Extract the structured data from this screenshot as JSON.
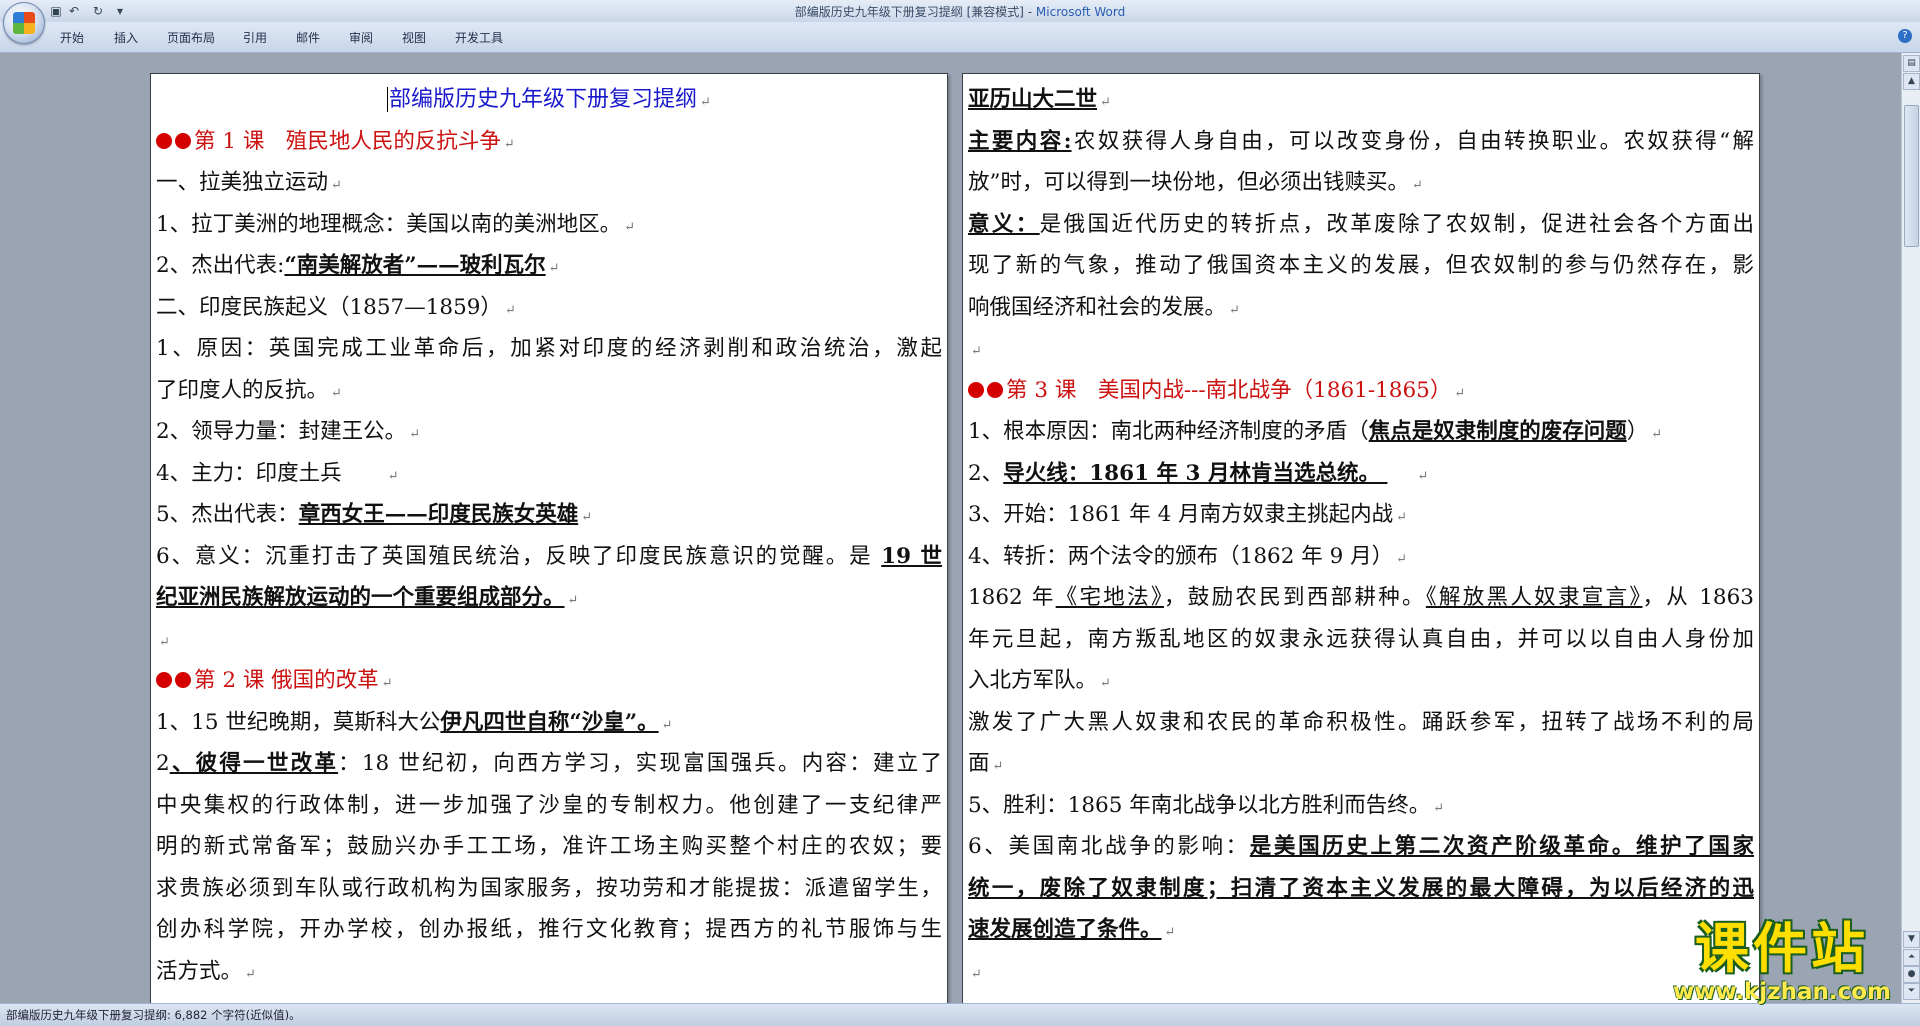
{
  "window": {
    "title": "部编版历史九年级下册复习提纲 [兼容模式] - ",
    "app": "Microsoft Word"
  },
  "ribbon_tabs": [
    "开始",
    "插入",
    "页面布局",
    "引用",
    "邮件",
    "审阅",
    "视图",
    "开发工具"
  ],
  "left_page": [
    [
      {
        "t": "部编版历史九年级下册复习提纲"
      }
    ],
    [
      {
        "t": "第 1 课　殖民地人民的反抗斗争"
      }
    ],
    [
      {
        "t": "一、拉美独立运动"
      }
    ],
    [
      {
        "t": "1、拉丁美洲的地理概念：美国以南的美洲地区。"
      }
    ],
    [
      {
        "t": "2、杰出代表:"
      },
      {
        "t": "“南美解放者”——玻利瓦尔"
      }
    ],
    [
      {
        "t": "二、印度民族起义（1857—1859）"
      }
    ],
    [
      {
        "t": "1、原因：英国完成工业革命后，加紧对印度的经济剥削和政治统治，激起"
      }
    ],
    [
      {
        "t": "了印度人的反抗。"
      }
    ],
    [
      {
        "t": "2、领导力量：封建王公。"
      }
    ],
    [
      {
        "t": "4、主力：印度土兵　　"
      }
    ],
    [
      {
        "t": "5、杰出代表："
      },
      {
        "t": "章西女王——印度民族女英雄"
      }
    ],
    [
      {
        "t": "6、意义：沉重打击了英国殖民统治，反映了印度民族意识的觉醒。是 "
      },
      {
        "t": "19 世"
      }
    ],
    [
      {
        "t": "纪亚洲民族解放运动的一个重要组成部分。"
      }
    ],
    [],
    [
      {
        "t": "第 2 课 俄国的改革"
      }
    ],
    [
      {
        "t": "1、15 世纪晚期，莫斯科大公"
      },
      {
        "t": "伊凡四世自称“沙皇”。"
      }
    ],
    [
      {
        "t": "2"
      },
      {
        "t": "、彼得一世改革"
      },
      {
        "t": "：18 世纪初，向西方学习，实现富国强兵。内容：建立了"
      }
    ],
    [
      {
        "t": "中央集权的行政体制，进一步加强了沙皇的专制权力。他创建了一支纪律严"
      }
    ],
    [
      {
        "t": "明的新式常备军；鼓励兴办手工工场，准许工场主购买整个村庄的农奴；要"
      }
    ],
    [
      {
        "t": "求贵族必须到车队或行政机构为国家服务，按功劳和才能提拔：派遣留学生，"
      }
    ],
    [
      {
        "t": "创办科学院，开办学校，创办报纸，推行文化教育；提西方的礼节服饰与生"
      }
    ],
    [
      {
        "t": "活方式。"
      }
    ]
  ],
  "right_page": [
    [
      {
        "t": "亚历山大二世"
      }
    ],
    [
      {
        "t": "主要内容:"
      },
      {
        "t": "农奴获得人身自由，可以改变身份，自由转换职业。农奴获得“解"
      }
    ],
    [
      {
        "t": "放”时，可以得到一块份地，但必须出钱赎买。"
      }
    ],
    [
      {
        "t": "意义："
      },
      {
        "t": "是俄国近代历史的转折点，改革废除了农奴制，促进社会各个方面出"
      }
    ],
    [
      {
        "t": "现了新的气象，推动了俄国资本主义的发展，但农奴制的参与仍然存在，影"
      }
    ],
    [
      {
        "t": "响俄国经济和社会的发展。"
      }
    ],
    [],
    [
      {
        "t": "第 3 课　美国内战---南北战争（1861-1865）"
      }
    ],
    [
      {
        "t": "1、根本原因：南北两种经济制度的矛盾（"
      },
      {
        "t": "焦点是奴隶制度的废存问题"
      },
      {
        "t": "）"
      }
    ],
    [
      {
        "t": "2、"
      },
      {
        "t": "导火线：1861 年 3 月林肯当选总统。 "
      }
    ],
    [
      {
        "t": "3、开始：1861 年 4 月南方奴隶主挑起内战"
      }
    ],
    [
      {
        "t": "4、转折：两个法令的颁布（1862 年 9 月）"
      }
    ],
    [
      {
        "t": "1862 年"
      },
      {
        "t": "《宅地法》"
      },
      {
        "t": "，鼓励农民到西部耕种。"
      },
      {
        "t": "《解放黑人奴隶宣言》"
      },
      {
        "t": "，从 1863"
      }
    ],
    [
      {
        "t": "年元旦起，南方叛乱地区的奴隶永远获得认真自由，并可以以自由人身份加"
      }
    ],
    [
      {
        "t": "入北方军队。"
      }
    ],
    [
      {
        "t": "激发了广大黑人奴隶和农民的革命积极性。踊跃参军，扭转了战场不利的局"
      }
    ],
    [
      {
        "t": "面"
      }
    ],
    [
      {
        "t": "5、胜利：1865 年南北战争以北方胜利而告终。"
      }
    ],
    [
      {
        "t": "6、美国南北战争的影响："
      },
      {
        "t": "是美国历史上第二次资产阶级革命。维护了国家"
      }
    ],
    [
      {
        "t": "统一，废除了奴隶制度；扫清了资本主义发展的最大障碍，为以后经济的迅"
      }
    ],
    [
      {
        "t": "速发展创造了条件。"
      }
    ],
    []
  ],
  "status": {
    "text": "部编版历史九年级下册复习提纲: 6,882 个字符(近似值)。"
  },
  "watermark": {
    "title": "课件站",
    "url": "www.kjzhan.com"
  },
  "colors": {
    "title_blue": "#1a1acc",
    "lesson_red": "#cc1111",
    "watermark_yellow": "#ffde00"
  }
}
